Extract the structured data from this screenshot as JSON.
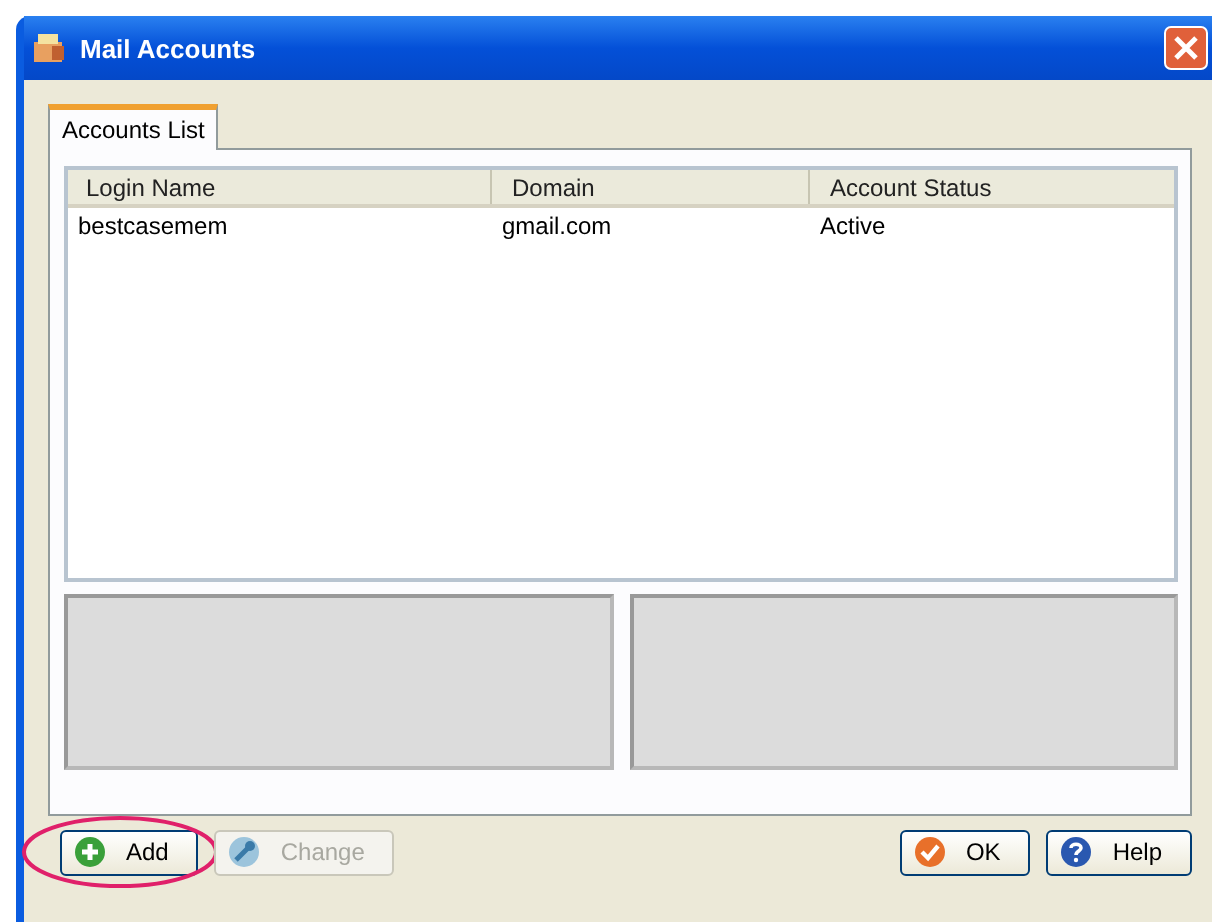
{
  "window": {
    "title": "Mail Accounts"
  },
  "tabs": [
    {
      "label": "Accounts List",
      "selected": true
    }
  ],
  "table": {
    "columns": [
      "Login Name",
      "Domain",
      "Account Status"
    ],
    "rows": [
      [
        "bestcasemem",
        "gmail.com",
        "Active"
      ]
    ]
  },
  "buttons_left": [
    {
      "label": "Add",
      "kind": "add",
      "disabled": false,
      "highlighted": true
    },
    {
      "label": "Change",
      "kind": "change",
      "disabled": true,
      "highlighted": false
    }
  ],
  "buttons_right": [
    {
      "label": "OK",
      "kind": "ok",
      "disabled": false
    },
    {
      "label": "Help",
      "kind": "help",
      "disabled": false
    }
  ]
}
